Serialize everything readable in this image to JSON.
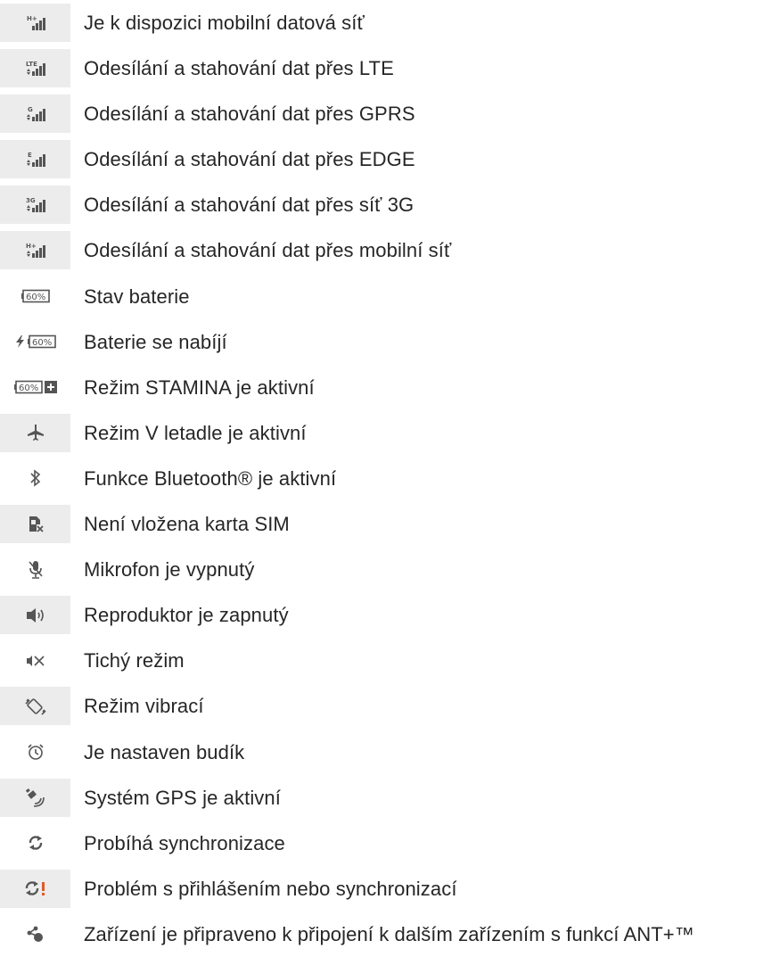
{
  "rows": [
    {
      "icon": "signal-hplus-icon",
      "text": "Je k dispozici mobilní datová síť",
      "badge": "H+"
    },
    {
      "icon": "signal-lte-icon",
      "text": "Odesílání a stahování dat přes LTE",
      "badge": "LTE"
    },
    {
      "icon": "signal-gprs-icon",
      "text": "Odesílání a stahování dat přes GPRS",
      "badge": "G"
    },
    {
      "icon": "signal-edge-icon",
      "text": "Odesílání a stahování dat přes EDGE",
      "badge": "E"
    },
    {
      "icon": "signal-3g-icon",
      "text": "Odesílání a stahování dat přes síť 3G",
      "badge": "3G"
    },
    {
      "icon": "signal-hplus-data-icon",
      "text": "Odesílání a stahování dat přes mobilní síť",
      "badge": "H+"
    },
    {
      "icon": "battery-icon",
      "text": "Stav baterie",
      "badge": "60%"
    },
    {
      "icon": "battery-charging-icon",
      "text": "Baterie se nabíjí",
      "badge": "60%"
    },
    {
      "icon": "battery-stamina-icon",
      "text": "Režim STAMINA je aktivní",
      "badge": "60%"
    },
    {
      "icon": "airplane-icon",
      "text": "Režim V letadle je aktivní"
    },
    {
      "icon": "bluetooth-icon",
      "text": "Funkce Bluetooth® je aktivní"
    },
    {
      "icon": "no-sim-icon",
      "text": "Není vložena karta SIM"
    },
    {
      "icon": "mic-muted-icon",
      "text": "Mikrofon je vypnutý"
    },
    {
      "icon": "speaker-icon",
      "text": "Reproduktor je zapnutý"
    },
    {
      "icon": "silent-icon",
      "text": "Tichý režim"
    },
    {
      "icon": "vibrate-icon",
      "text": "Režim vibrací"
    },
    {
      "icon": "alarm-icon",
      "text": "Je nastaven budík"
    },
    {
      "icon": "gps-icon",
      "text": "Systém GPS je aktivní"
    },
    {
      "icon": "sync-icon",
      "text": "Probíhá synchronizace"
    },
    {
      "icon": "sync-error-icon",
      "text": "Problém s přihlášením nebo synchronizací"
    },
    {
      "icon": "ant-plus-icon",
      "text": "Zařízení je připraveno k připojení k dalším zařízením s funkcí ANT+™"
    }
  ],
  "colors": {
    "shade": "#ececec",
    "icon": "#555555",
    "text": "#262626",
    "alert": "#e05a2a"
  }
}
